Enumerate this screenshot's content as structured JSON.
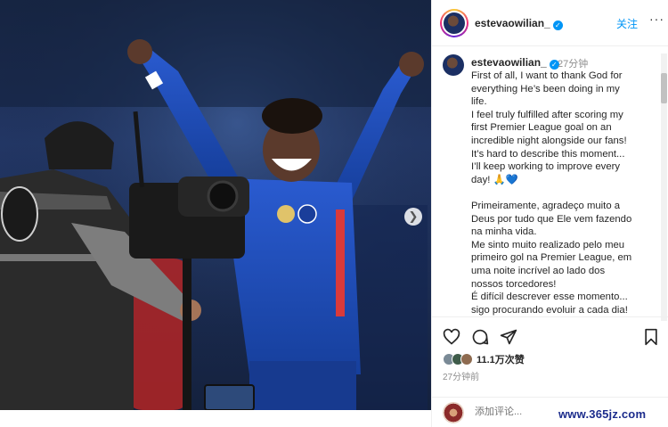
{
  "header": {
    "username": "estevaowilian_",
    "follow_label": "关注",
    "more_label": "···"
  },
  "caption": {
    "username": "estevaowilian_",
    "time": "27分钟",
    "lines_en": [
      "First of all, I want to thank God for",
      "everything He’s been doing in my",
      "life.",
      "I feel truly fulfilled after scoring my",
      "first Premier League goal on an",
      "incredible night alongside our fans!",
      "It’s hard to describe this moment...",
      "I’ll keep working to improve every",
      "day! 🙏💙"
    ],
    "lines_pt": [
      "Primeiramente, agradeço muito a",
      "Deus por tudo que Ele vem fazendo",
      "na minha vida.",
      "Me sinto muito realizado pelo meu",
      "primeiro gol na Premier League, em",
      "uma noite incrível ao lado dos",
      "nossos torcedores!",
      "É difícil descrever esse momento...",
      "sigo procurando evoluir a cada dia!",
      "🙏💙"
    ]
  },
  "actions": {
    "likes": "11.1万次赞",
    "post_time": "27分钟前"
  },
  "comment": {
    "placeholder": "添加评论..."
  },
  "watermark": "www.365jz.com",
  "icons": {
    "like": "heart-icon",
    "comment": "comment-icon",
    "share": "send-icon",
    "save": "bookmark-icon",
    "next": "chevron-right-icon"
  },
  "colors": {
    "accent": "#0095f6",
    "watermark": "#1c2c8c",
    "kit_blue": "#1f4fb8"
  }
}
